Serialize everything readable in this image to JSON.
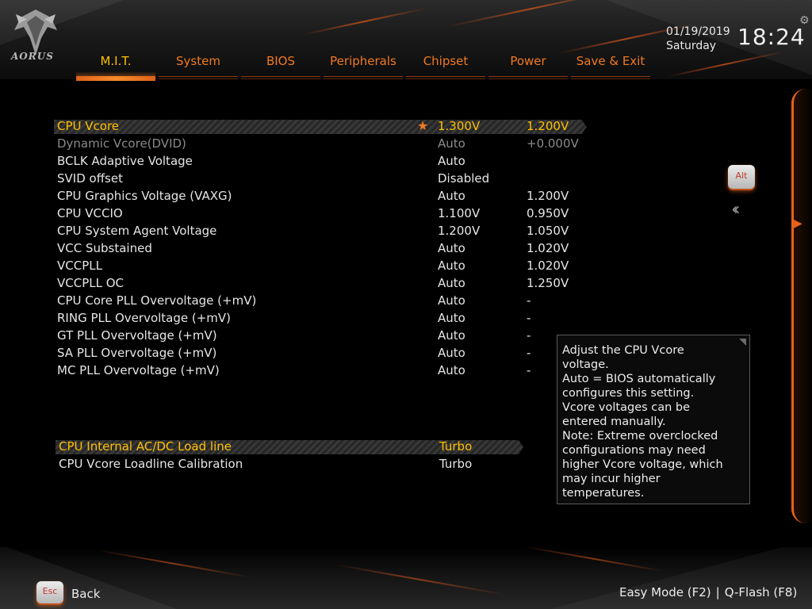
{
  "brand": {
    "logo_text": "AORUS"
  },
  "header": {
    "tabs": [
      {
        "label": "M.I.T.",
        "active": true
      },
      {
        "label": "System",
        "active": false
      },
      {
        "label": "BIOS",
        "active": false
      },
      {
        "label": "Peripherals",
        "active": false
      },
      {
        "label": "Chipset",
        "active": false
      },
      {
        "label": "Power",
        "active": false
      },
      {
        "label": "Save & Exit",
        "active": false
      }
    ],
    "date": "01/19/2019",
    "weekday": "Saturday",
    "time": "18:24"
  },
  "settings": [
    {
      "label": "CPU Vcore",
      "value": "1.300V",
      "current": "1.200V",
      "state": "selected",
      "starred": true
    },
    {
      "label": "Dynamic Vcore(DVID)",
      "value": "Auto",
      "current": "+0.000V",
      "state": "disabled"
    },
    {
      "label": "BCLK Adaptive Voltage",
      "value": "Auto",
      "current": ""
    },
    {
      "label": "SVID offset",
      "value": "Disabled",
      "current": ""
    },
    {
      "label": "CPU Graphics Voltage (VAXG)",
      "value": "Auto",
      "current": "1.200V"
    },
    {
      "label": "CPU VCCIO",
      "value": "1.100V",
      "current": "0.950V"
    },
    {
      "label": "CPU System Agent Voltage",
      "value": "1.200V",
      "current": "1.050V"
    },
    {
      "label": "VCC Substained",
      "value": "Auto",
      "current": "1.020V"
    },
    {
      "label": "VCCPLL",
      "value": "Auto",
      "current": "1.020V"
    },
    {
      "label": "VCCPLL OC",
      "value": "Auto",
      "current": "1.250V"
    },
    {
      "label": "CPU Core PLL Overvoltage (+mV)",
      "value": "Auto",
      "current": "-"
    },
    {
      "label": "RING PLL Overvoltage (+mV)",
      "value": "Auto",
      "current": "-"
    },
    {
      "label": "GT PLL Overvoltage (+mV)",
      "value": "Auto",
      "current": "-"
    },
    {
      "label": "SA PLL Overvoltage (+mV)",
      "value": "Auto",
      "current": "-"
    },
    {
      "label": "MC PLL Overvoltage (+mV)",
      "value": "Auto",
      "current": "-"
    }
  ],
  "loadline": [
    {
      "label": "CPU Internal AC/DC Load line",
      "value": "Turbo",
      "state": "highlighted"
    },
    {
      "label": "CPU Vcore Loadline Calibration",
      "value": "Turbo"
    }
  ],
  "side": {
    "alt_key": "Alt",
    "collapse_icon": "double-chevron-left-icon"
  },
  "help": {
    "lines": [
      "Adjust the CPU Vcore",
      "voltage.",
      "Auto = BIOS automatically",
      "configures this setting.",
      "Vcore voltages can be",
      "entered manually.",
      "Note: Extreme overclocked",
      "configurations may need",
      "higher Vcore voltage, which",
      "may incur higher",
      "temperatures."
    ]
  },
  "footer": {
    "esc_key": "Esc",
    "back_label": "Back",
    "easy_mode": "Easy Mode (F2)",
    "separator": "|",
    "qflash": "Q-Flash (F8)"
  },
  "colors": {
    "accent": "#f07a22",
    "selected_text": "#ffc000",
    "text": "#e6e6e6",
    "dim_text": "#8a8a8a"
  }
}
